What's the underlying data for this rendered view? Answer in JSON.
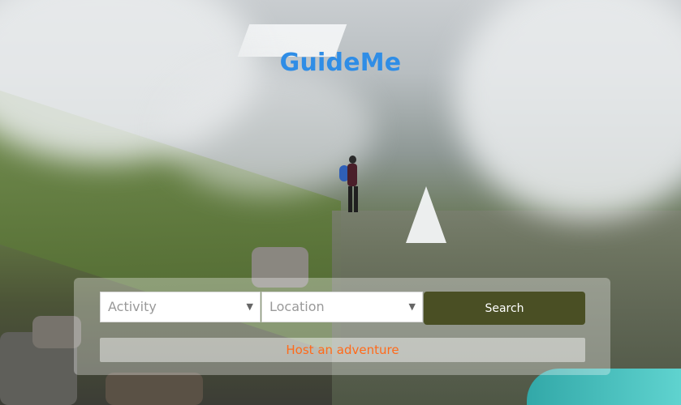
{
  "brand": {
    "name": "GuideMe",
    "color": "#2f8de6"
  },
  "search": {
    "activity_placeholder": "Activity",
    "location_placeholder": "Location",
    "search_label": "Search"
  },
  "cta": {
    "host_label": "Host an adventure",
    "color": "#ff6a1a"
  },
  "icons": {
    "dropdown_caret": "chevron-down-icon"
  },
  "background": {
    "subject": "hiker on misty mountain ridge"
  }
}
